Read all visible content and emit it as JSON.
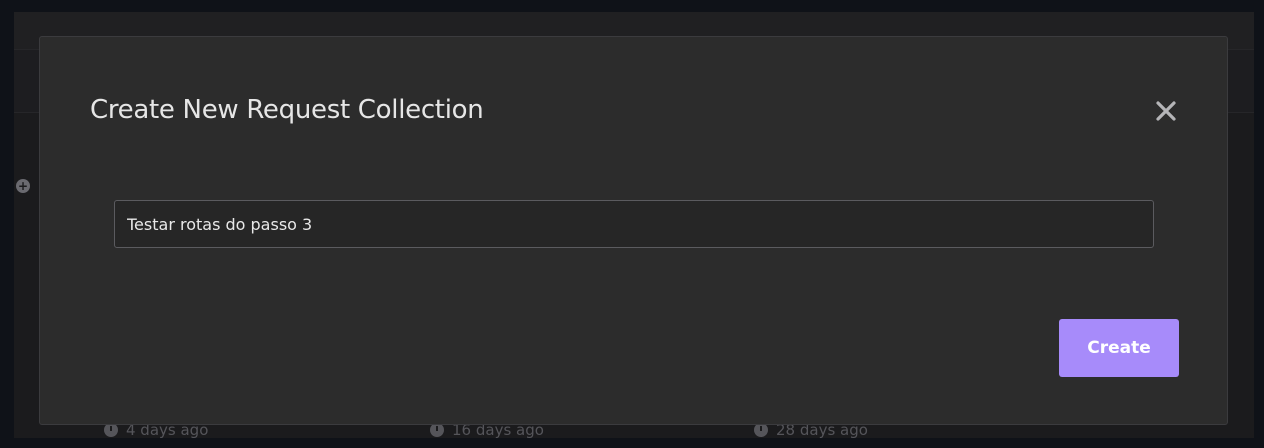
{
  "background": {
    "timestamps": [
      "4 days ago",
      "16 days ago",
      "28 days ago"
    ]
  },
  "modal": {
    "title": "Create New Request Collection",
    "close_icon": "close-icon",
    "name_input_value": "Testar rotas do passo 3",
    "create_label": "Create"
  },
  "colors": {
    "accent": "#a78bfa",
    "modal_bg": "#2c2c2c",
    "page_bg": "#1b1b1d"
  }
}
